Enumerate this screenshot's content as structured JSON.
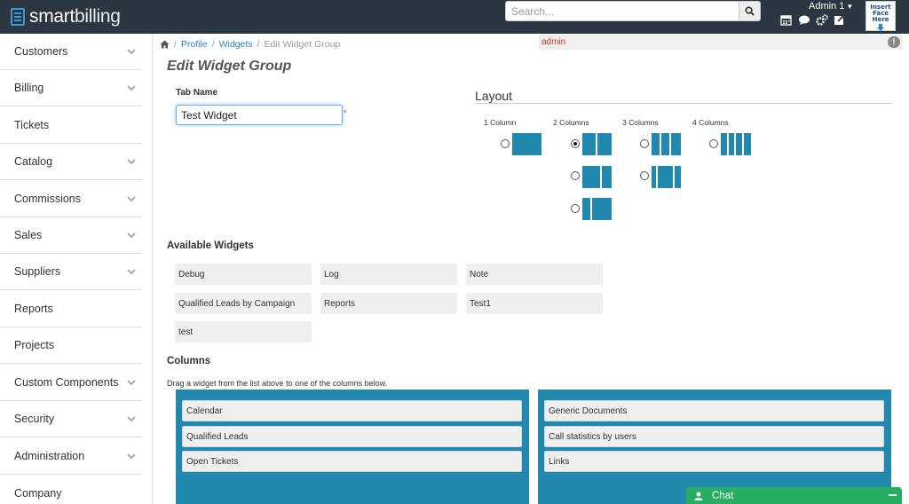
{
  "header": {
    "logo_prefix": "smart",
    "logo_suffix": "billing",
    "search_placeholder": "Search...",
    "user_name": "Admin 1",
    "avatar_text": "Insert Face Here"
  },
  "sidebar": {
    "items": [
      {
        "label": "Customers",
        "has_chevron": true
      },
      {
        "label": "Billing",
        "has_chevron": true
      },
      {
        "label": "Tickets",
        "has_chevron": false
      },
      {
        "label": "Catalog",
        "has_chevron": true
      },
      {
        "label": "Commissions",
        "has_chevron": true
      },
      {
        "label": "Sales",
        "has_chevron": true
      },
      {
        "label": "Suppliers",
        "has_chevron": true
      },
      {
        "label": "Reports",
        "has_chevron": false
      },
      {
        "label": "Projects",
        "has_chevron": false
      },
      {
        "label": "Custom Components",
        "has_chevron": true
      },
      {
        "label": "Security",
        "has_chevron": true
      },
      {
        "label": "Administration",
        "has_chevron": true
      },
      {
        "label": "Company",
        "has_chevron": false
      }
    ]
  },
  "breadcrumb": {
    "items": [
      "Profile",
      "Widgets"
    ],
    "current": "Edit Widget Group",
    "separator": "/"
  },
  "admin_bar": {
    "role": "admin",
    "alert": "!"
  },
  "page": {
    "title": "Edit Widget Group"
  },
  "form": {
    "tab_name_label": "Tab Name",
    "tab_name_value": "Test Widget"
  },
  "layout": {
    "title": "Layout",
    "options": [
      "1 Column",
      "2 Columns",
      "3 Columns",
      "4 Columns"
    ],
    "selected": "2 Columns"
  },
  "available_widgets": {
    "title": "Available Widgets",
    "items": [
      "Debug",
      "Log",
      "Note",
      "Qualified Leads by Campaign",
      "Reports",
      "Test1",
      "test"
    ]
  },
  "columns": {
    "title": "Columns",
    "hint": "Drag a widget from the list above to one of the columns below.",
    "left": [
      "Calendar",
      "Qualified Leads",
      "Open Tickets"
    ],
    "right": [
      "Generic Documents",
      "Call statistics by users",
      "Links"
    ]
  },
  "chat": {
    "label": "Chat"
  },
  "colors": {
    "topbar": "#2b3641",
    "accent": "#2189ae",
    "link": "#2a7fbf",
    "chat": "#27ae60"
  }
}
